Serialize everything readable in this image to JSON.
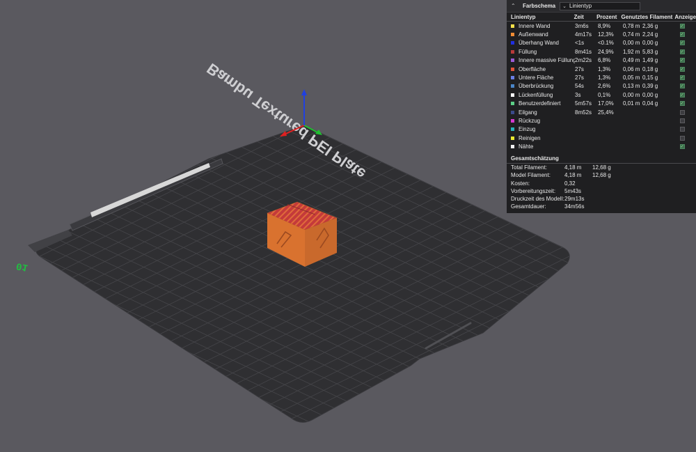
{
  "plate": {
    "label": "Bambu Textured PEI Plate",
    "number": "01"
  },
  "legend": {
    "title": "Farbschema",
    "selector_value": "Linientyp",
    "columns": [
      "Linientyp",
      "Zeit",
      "Prozent",
      "Genutztes Filament",
      "Anzeige"
    ],
    "rows": [
      {
        "name": "Innere Wand",
        "color": "#f4e04a",
        "time": "3m6s",
        "percent": "8,9%",
        "length": "0,78 m",
        "weight": "2,36 g",
        "shown": true
      },
      {
        "name": "Außenwand",
        "color": "#f08c34",
        "time": "4m17s",
        "percent": "12,3%",
        "length": "0,74 m",
        "weight": "2,24 g",
        "shown": true
      },
      {
        "name": "Überhang Wand",
        "color": "#1f2fe0",
        "time": "<1s",
        "percent": "<0.1%",
        "length": "0,00 m",
        "weight": "0,00 g",
        "shown": true
      },
      {
        "name": "Füllung",
        "color": "#b83a3a",
        "time": "8m41s",
        "percent": "24,9%",
        "length": "1,92 m",
        "weight": "5,83 g",
        "shown": true
      },
      {
        "name": "Innere massive Füllung",
        "color": "#9a5bd6",
        "time": "2m22s",
        "percent": "6,8%",
        "length": "0,49 m",
        "weight": "1,49 g",
        "shown": true
      },
      {
        "name": "Oberfläche",
        "color": "#e0533a",
        "time": "27s",
        "percent": "1,3%",
        "length": "0,06 m",
        "weight": "0,18 g",
        "shown": true
      },
      {
        "name": "Untere Fläche",
        "color": "#6a7fe6",
        "time": "27s",
        "percent": "1,3%",
        "length": "0,05 m",
        "weight": "0,15 g",
        "shown": true
      },
      {
        "name": "Überbrückung",
        "color": "#4a86c8",
        "time": "54s",
        "percent": "2,6%",
        "length": "0,13 m",
        "weight": "0,39 g",
        "shown": true
      },
      {
        "name": "Lückenfüllung",
        "color": "#ffffff",
        "time": "3s",
        "percent": "0,1%",
        "length": "0,00 m",
        "weight": "0,00 g",
        "shown": true
      },
      {
        "name": "Benutzerdefiniert",
        "color": "#5cd086",
        "time": "5m57s",
        "percent": "17,0%",
        "length": "0,01 m",
        "weight": "0,04 g",
        "shown": true
      },
      {
        "name": "Eilgang",
        "color": "#3a4a8a",
        "time": "8m52s",
        "percent": "25,4%",
        "length": "",
        "weight": "",
        "shown": false
      },
      {
        "name": "Rückzug",
        "color": "#d63ad0",
        "time": "",
        "percent": "",
        "length": "",
        "weight": "",
        "shown": false
      },
      {
        "name": "Einzug",
        "color": "#2ab0b8",
        "time": "",
        "percent": "",
        "length": "",
        "weight": "",
        "shown": false
      },
      {
        "name": "Reinigen",
        "color": "#e8e830",
        "time": "",
        "percent": "",
        "length": "",
        "weight": "",
        "shown": false
      },
      {
        "name": "Nähte",
        "color": "#f0f0f0",
        "time": "",
        "percent": "",
        "length": "",
        "weight": "",
        "shown": true
      }
    ],
    "summary": {
      "title": "Gesamtschätzung",
      "rows": [
        {
          "label": "Total Filament:",
          "v1": "4,18 m",
          "v2": "12,68 g"
        },
        {
          "label": "Model Filament:",
          "v1": "4,18 m",
          "v2": "12,68 g"
        },
        {
          "label": "Kosten:",
          "v1": "0,32",
          "v2": ""
        },
        {
          "label": "Vorbereitungszeit:",
          "v1": "5m43s",
          "v2": ""
        },
        {
          "label": "Druckzeit des Modell:",
          "v1": "29m13s",
          "v2": ""
        },
        {
          "label": "Gesamtdauer:",
          "v1": "34m56s",
          "v2": ""
        }
      ]
    }
  },
  "colors": {
    "background": "#5a595f",
    "plate": "#2f2f32",
    "grid": "#46464a",
    "cube_side": "#d9722f",
    "cube_top": "#c43a3a",
    "axis_x": "#e02020",
    "axis_y": "#20c030",
    "axis_z": "#2040e0"
  }
}
